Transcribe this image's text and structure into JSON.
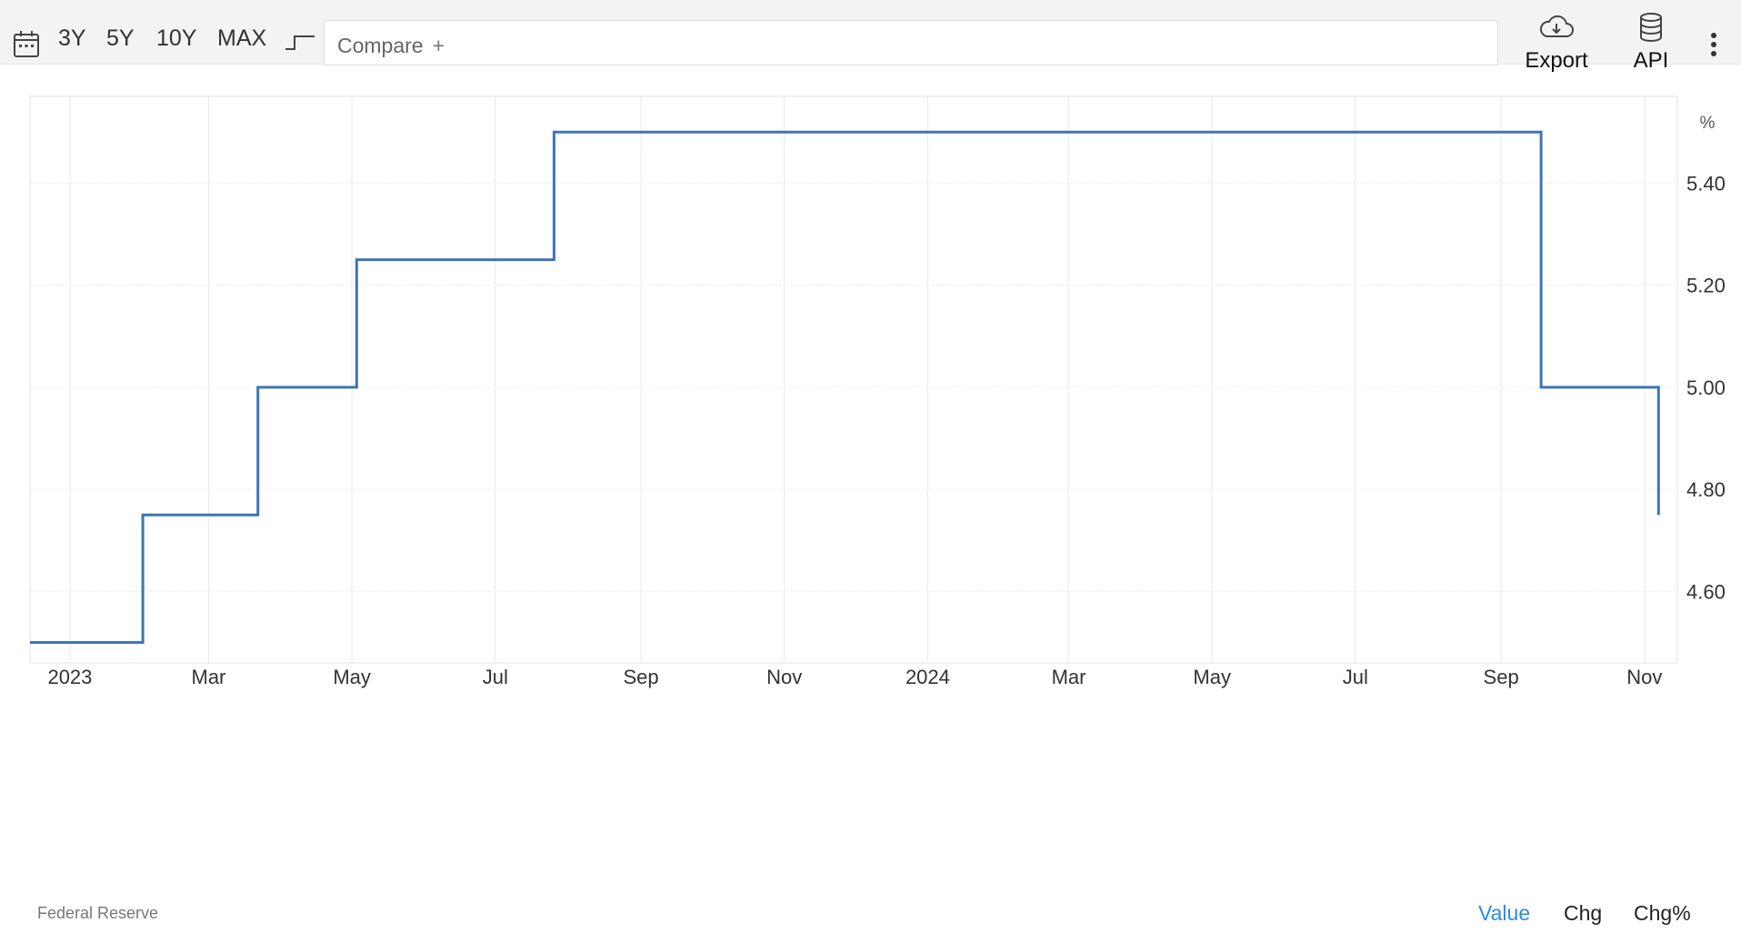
{
  "toolbar": {
    "ranges": [
      "3Y",
      "5Y",
      "10Y",
      "MAX"
    ],
    "compare_placeholder": "Compare",
    "compare_plus": "+",
    "export_label": "Export",
    "api_label": "API"
  },
  "footer": {
    "source": "Federal Reserve",
    "tabs": [
      "Value",
      "Chg",
      "Chg%"
    ],
    "active_tab": "Value"
  },
  "colors": {
    "line": "#3f74b5",
    "active_tab": "#2c8be5",
    "grid": "#e9e9e9"
  },
  "chart_data": {
    "type": "line",
    "step": true,
    "unit_label": "%",
    "x_ticks": [
      "2023",
      "Mar",
      "May",
      "Jul",
      "Sep",
      "Nov",
      "2024",
      "Mar",
      "May",
      "Jul",
      "Sep",
      "Nov"
    ],
    "x_range": [
      "2022-12-15",
      "2024-11-15"
    ],
    "ylim": [
      4.46,
      5.57
    ],
    "y_ticks": [
      4.6,
      4.8,
      5.0,
      5.2,
      5.4
    ],
    "grid": true,
    "series": [
      {
        "x": [
          "2022-12-15",
          "2023-02-01",
          "2023-03-22",
          "2023-05-03",
          "2023-07-26",
          "2024-09-18",
          "2024-11-07"
        ],
        "values": [
          4.5,
          4.75,
          5.0,
          5.25,
          5.5,
          5.0,
          4.75
        ]
      }
    ]
  }
}
